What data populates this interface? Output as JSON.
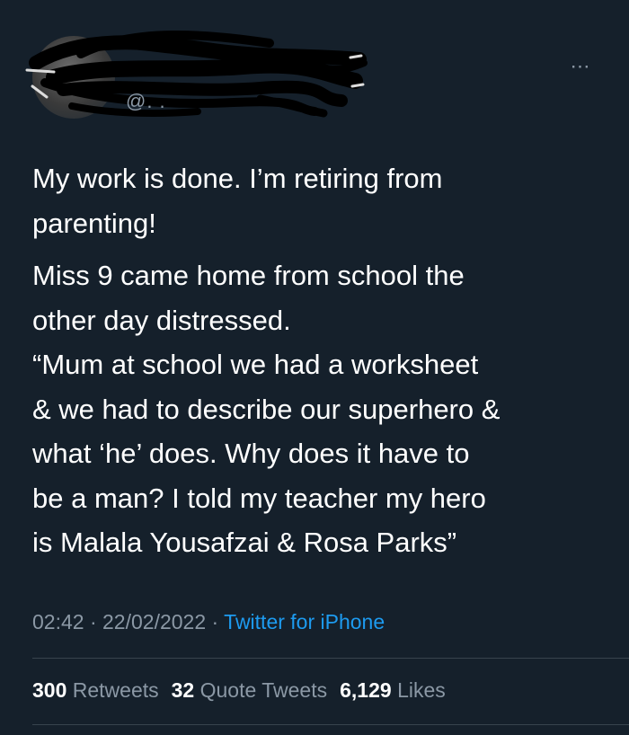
{
  "tweet": {
    "author": {
      "handle_fragment": "@. ."
    },
    "more_icon": "⋯",
    "paragraphs": [
      "My work is done. I’m retiring from\nparenting!",
      "Miss 9 came home from school the\nother day distressed.\n“Mum at school we had a worksheet\n& we had to describe our superhero &\nwhat ‘he’ does. Why does it have to\nbe a man? I told my teacher my hero\nis Malala Yousafzai & Rosa Parks”"
    ],
    "time": "02:42",
    "separator": " · ",
    "date": "22/02/2022",
    "source": "Twitter for iPhone",
    "stats": {
      "retweets": {
        "count": "300",
        "label": "Retweets"
      },
      "quotes": {
        "count": "32",
        "label": "Quote Tweets"
      },
      "likes": {
        "count": "6,129",
        "label": "Likes"
      }
    }
  },
  "colors": {
    "background": "#15202b",
    "text": "#ffffff",
    "secondary": "#8b98a5",
    "link": "#1d9bf0",
    "divider": "#38444d"
  }
}
